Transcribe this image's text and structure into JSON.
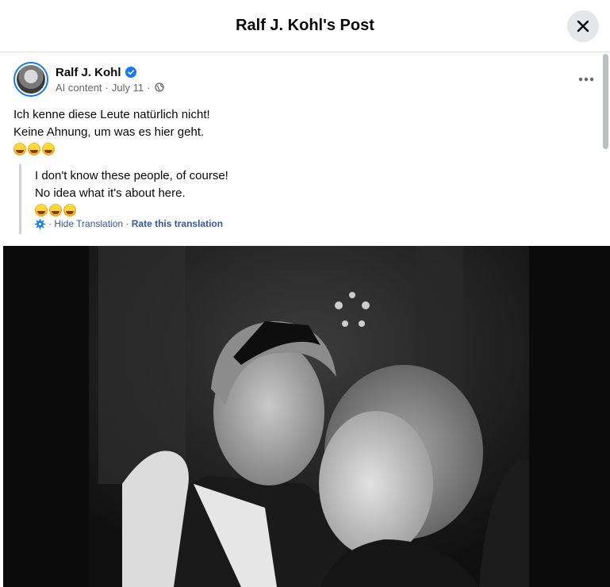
{
  "modal": {
    "title": "Ralf J. Kohl's Post",
    "close_icon": "close-icon"
  },
  "post": {
    "author": "Ralf J. Kohl",
    "verified_icon": "verified-badge-icon",
    "meta": {
      "label": "AI content",
      "date": "July 11",
      "audience_icon": "globe-icon"
    },
    "more_icon": "more-options-icon",
    "text_lines": [
      "Ich kenne diese Leute natürlich nicht!",
      "Keine Ahnung, um was es hier geht."
    ],
    "emojis": [
      "rolling-on-floor-laughing",
      "rolling-on-floor-laughing",
      "rolling-on-floor-laughing"
    ],
    "translation": {
      "lines": [
        "I don't know these people, of course!",
        "No idea what it's about here."
      ],
      "hide_label": "Hide Translation",
      "rate_label": "Rate this translation",
      "settings_icon": "gear-icon"
    },
    "photo": {
      "description_icon": "photo-image"
    }
  },
  "colors": {
    "accent": "#1877f2",
    "link": "#385898",
    "meta": "#65676b",
    "divider": "#dddfe2"
  }
}
